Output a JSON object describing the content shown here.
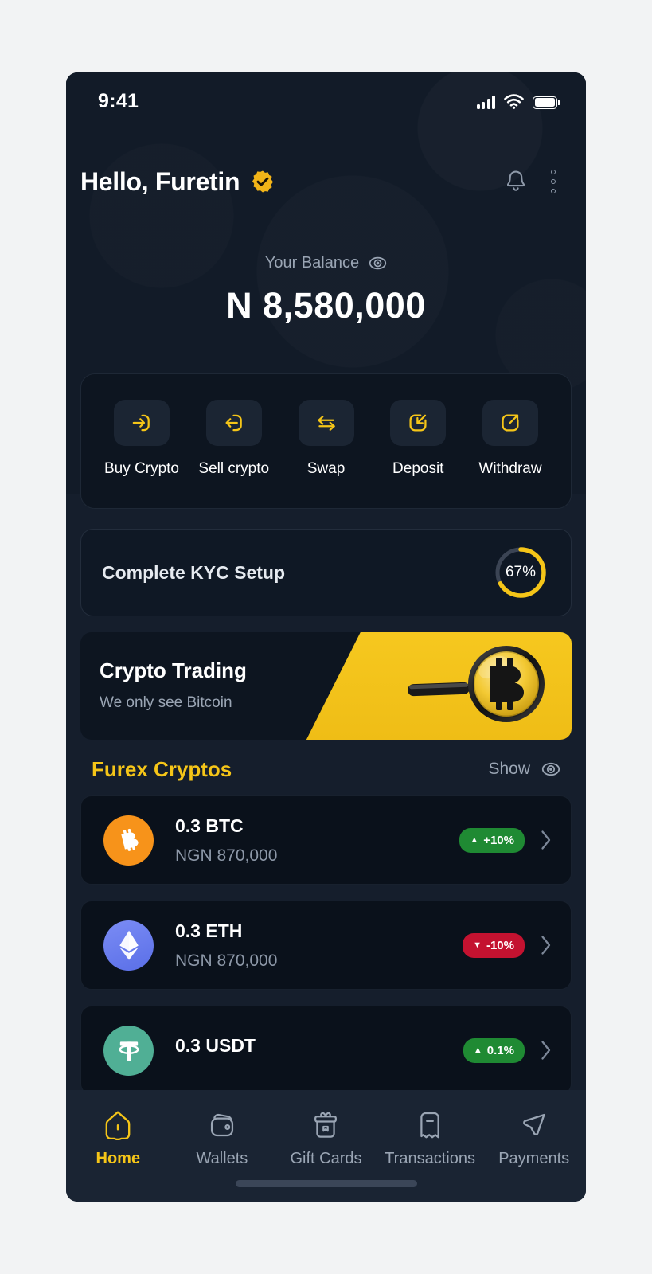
{
  "status_bar": {
    "time": "9:41",
    "signal_icon": "signal-bars-icon",
    "wifi_icon": "wifi-icon",
    "battery_icon": "battery-full-icon"
  },
  "header": {
    "greeting": "Hello, Furetin",
    "verified_badge_icon": "verified-badge-icon",
    "notification_icon": "bell-icon",
    "menu_icon": "more-vertical-icon"
  },
  "balance": {
    "label": "Your Balance",
    "toggle_icon": "eye-icon",
    "amount": "N 8,580,000"
  },
  "quick_actions": [
    {
      "label": "Buy Crypto",
      "icon": "login-arrow-icon"
    },
    {
      "label": "Sell crypto",
      "icon": "logout-arrow-icon"
    },
    {
      "label": "Swap",
      "icon": "swap-arrows-icon"
    },
    {
      "label": "Deposit",
      "icon": "arrow-into-box-icon"
    },
    {
      "label": "Withdraw",
      "icon": "arrow-out-of-box-icon"
    }
  ],
  "kyc": {
    "title": "Complete KYC Setup",
    "percent_label": "67%",
    "percent_value": 67,
    "ring_color": "#f5c518",
    "track_color": "#3b4454"
  },
  "promo": {
    "title": "Crypto Trading",
    "subtitle": "We only see Bitcoin",
    "art_icon": "magnifier-bitcoin-icon",
    "accent_color": "#f6c81f"
  },
  "cryptos_section": {
    "title": "Furex Cryptos",
    "show_label": "Show",
    "show_icon": "eye-icon"
  },
  "cryptos": [
    {
      "symbol_icon": "bitcoin-icon",
      "amount": "0.3 BTC",
      "fiat": "NGN 870,000",
      "change": "+10%",
      "direction": "up",
      "badge_color": "#1f8a33",
      "coin_color": "#f7931a",
      "chevron_icon": "chevron-right-icon"
    },
    {
      "symbol_icon": "ethereum-icon",
      "amount": "0.3 ETH",
      "fiat": "NGN 870,000",
      "change": "-10%",
      "direction": "down",
      "badge_color": "#c41230",
      "coin_color": "#5a6fe8",
      "chevron_icon": "chevron-right-icon"
    },
    {
      "symbol_icon": "tether-icon",
      "amount": "0.3 USDT",
      "fiat": "",
      "change": "0.1%",
      "direction": "up",
      "badge_color": "#1f8a33",
      "coin_color": "#50af95",
      "chevron_icon": "chevron-right-icon"
    }
  ],
  "bottom_nav": [
    {
      "label": "Home",
      "icon": "home-icon",
      "active": true
    },
    {
      "label": "Wallets",
      "icon": "wallet-icon",
      "active": false
    },
    {
      "label": "Gift Cards",
      "icon": "gift-icon",
      "active": false
    },
    {
      "label": "Transactions",
      "icon": "receipt-icon",
      "active": false
    },
    {
      "label": "Payments",
      "icon": "send-icon",
      "active": false
    }
  ]
}
